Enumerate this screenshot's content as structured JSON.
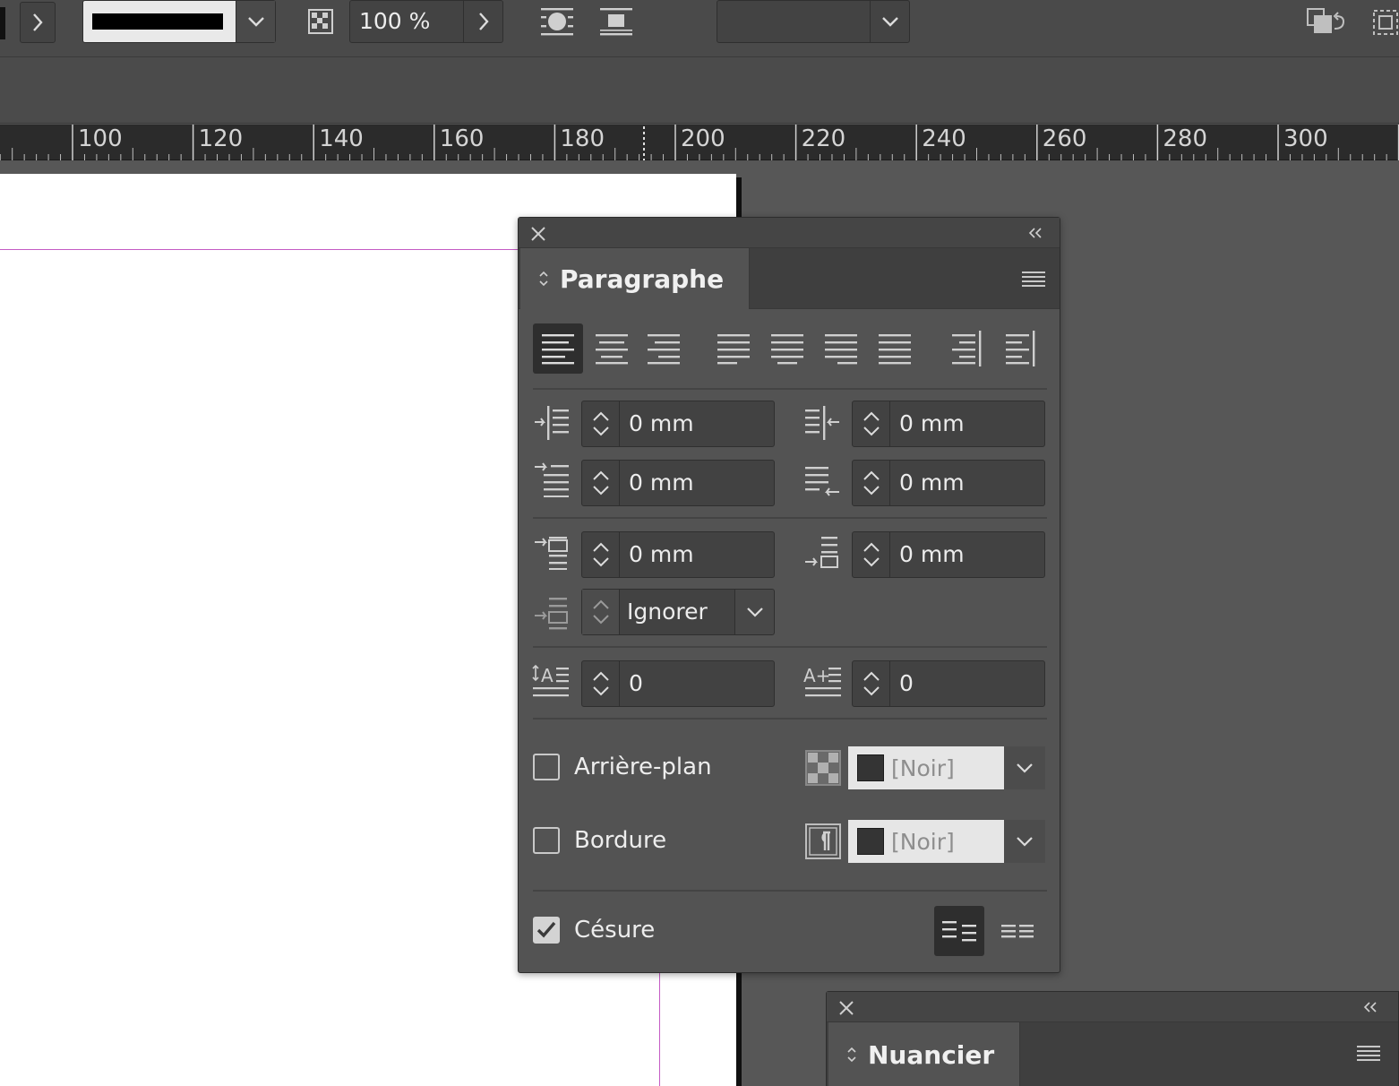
{
  "toolbar": {
    "opacity_value": "100 %",
    "stroke_color": "#000000",
    "empty_dropdown_value": ""
  },
  "ruler": {
    "labels": [
      "100",
      "120",
      "140",
      "160",
      "180",
      "200",
      "220",
      "240",
      "260",
      "280",
      "300"
    ]
  },
  "paragraph_panel": {
    "title": "Paragraphe",
    "alignment_buttons": [
      "align-left",
      "align-center",
      "align-right",
      "justify-left",
      "justify-center",
      "justify-right",
      "justify-all",
      "align-towards-spine",
      "align-away-from-spine"
    ],
    "active_alignment": "align-left",
    "left_indent": "0 mm",
    "right_indent": "0 mm",
    "first_line_indent": "0 mm",
    "last_line_right_indent": "0 mm",
    "space_before": "0 mm",
    "space_after": "0 mm",
    "align_to_grid": "Ignorer",
    "drop_cap_lines": "0",
    "drop_cap_chars": "0",
    "shading": {
      "label": "Arrière-plan",
      "checked": false,
      "color": "[Noir]"
    },
    "border": {
      "label": "Bordure",
      "checked": false,
      "color": "[Noir]"
    },
    "hyphenation": {
      "label": "Césure",
      "checked": true
    }
  },
  "swatch_panel": {
    "title": "Nuancier"
  },
  "colors": {
    "panel_bg": "#535353",
    "margin_guide": "#c45bc4",
    "page": "#ffffff"
  }
}
